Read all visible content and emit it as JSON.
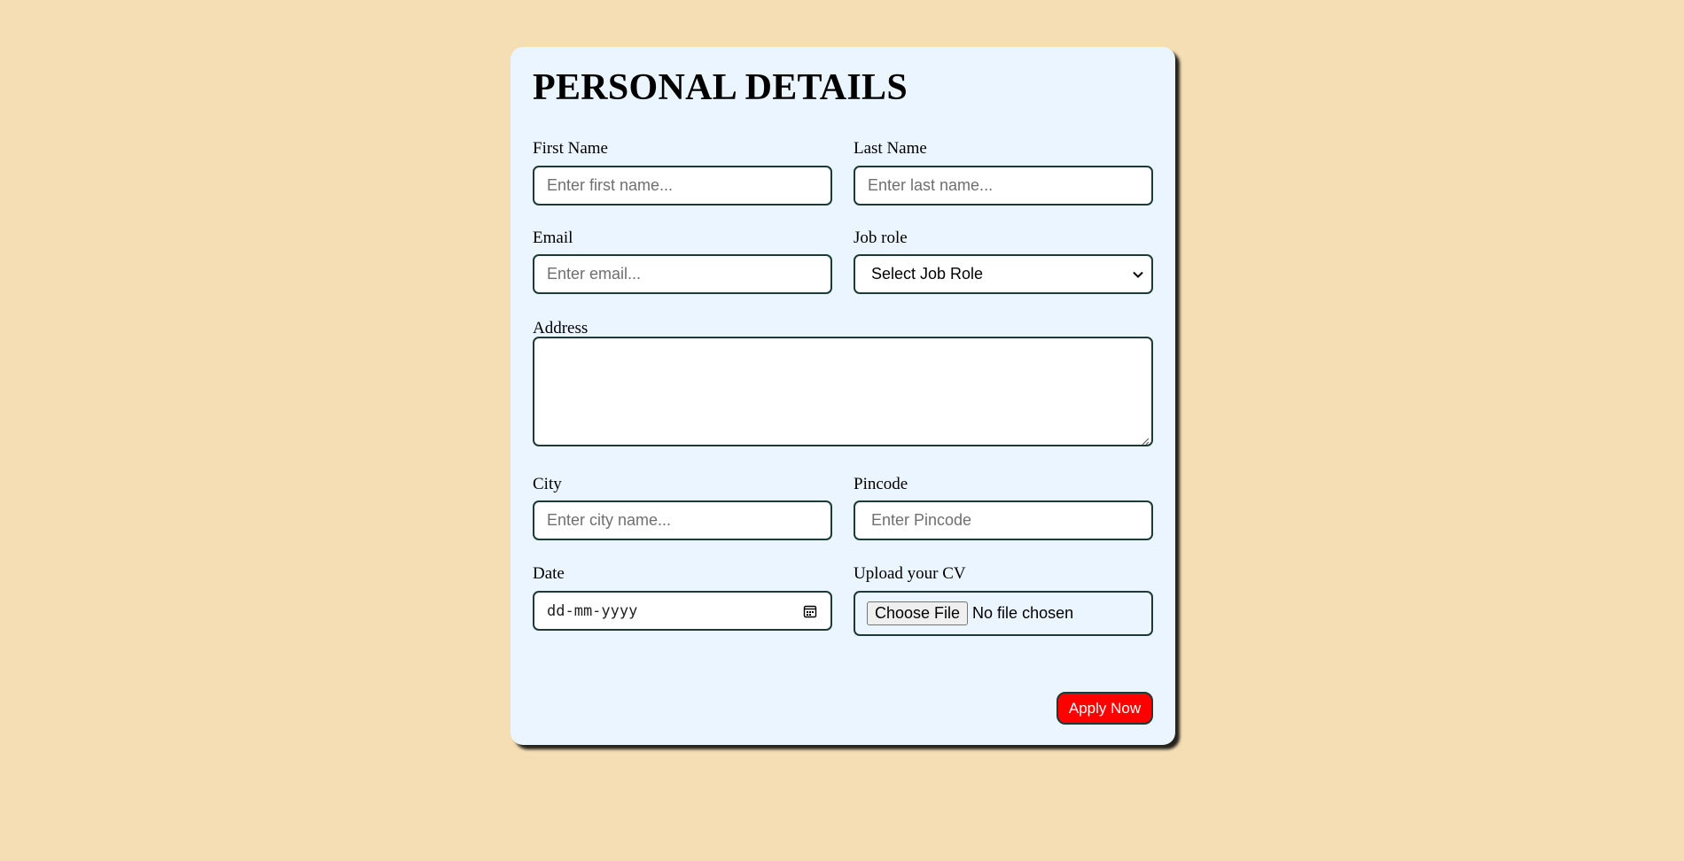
{
  "form": {
    "title": "PERSONAL DETAILS",
    "first_name": {
      "label": "First Name",
      "placeholder": "Enter first name...",
      "value": ""
    },
    "last_name": {
      "label": "Last Name",
      "placeholder": "Enter last name...",
      "value": ""
    },
    "email": {
      "label": "Email",
      "placeholder": "Enter email...",
      "value": ""
    },
    "job_role": {
      "label": "Job role",
      "selected": "Select Job Role"
    },
    "address": {
      "label": "Address",
      "value": ""
    },
    "city": {
      "label": "City",
      "placeholder": "Enter city name...",
      "value": ""
    },
    "pincode": {
      "label": "Pincode",
      "placeholder": "Enter Pincode",
      "value": ""
    },
    "date": {
      "label": "Date",
      "placeholder": "dd-mm-yyyy"
    },
    "cv": {
      "label": "Upload your CV",
      "button_label": "Choose File",
      "status": "No file chosen"
    },
    "submit_label": "Apply Now"
  },
  "colors": {
    "background": "#f5deb3",
    "card": "#ebf5ff",
    "border": "#1c3b36",
    "submit": "#ff0000"
  },
  "icons": {
    "job_role_dropdown": "chevron-down-icon",
    "date_picker": "calendar-icon",
    "address_resize": "resize-grip-icon"
  }
}
